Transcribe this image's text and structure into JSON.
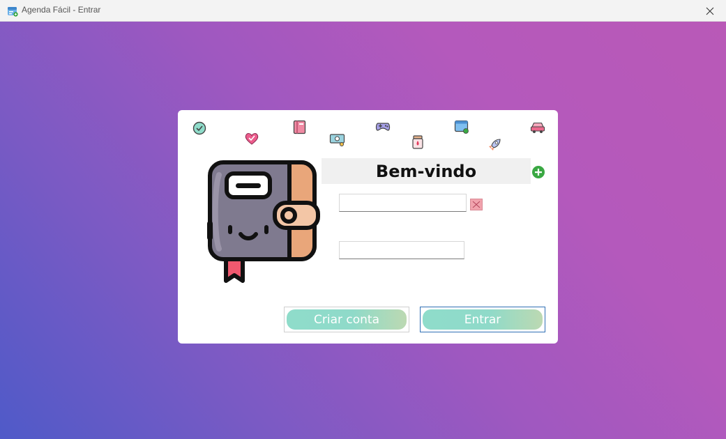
{
  "window": {
    "title": "Agenda Fácil - Entrar",
    "app_icon": "calendar-app-icon",
    "close_icon": "close-icon"
  },
  "login": {
    "welcome": "Bem-vindo",
    "username_value": "",
    "password_value": "",
    "create_account_label": "Criar conta",
    "enter_label": "Entrar"
  },
  "icons": {
    "hero": "wallet-agenda-icon",
    "add": "plus-circle-icon",
    "clear": "clear-x-icon",
    "decorations": [
      "check-badge-icon",
      "heart-icon",
      "book-icon",
      "money-icon",
      "gamepad-icon",
      "jar-icon",
      "browser-window-icon",
      "rocket-icon",
      "car-icon"
    ]
  },
  "colors": {
    "primary_border": "#2f6fb5",
    "button_gradient_start": "#8fdcca",
    "button_gradient_end": "#bcd9b2",
    "add_green": "#3aa843"
  }
}
